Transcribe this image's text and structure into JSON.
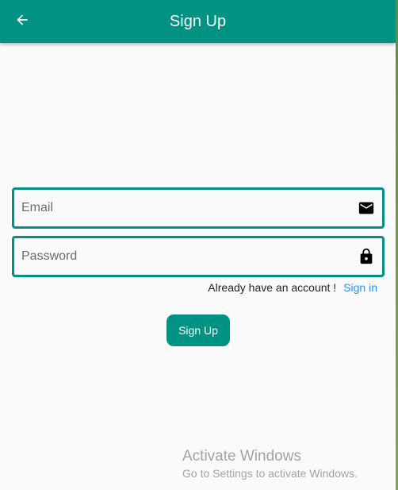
{
  "appbar": {
    "title": "Sign Up",
    "back_icon": "arrow-left-icon",
    "color": "#009384"
  },
  "form": {
    "email": {
      "placeholder": "Email",
      "value": "",
      "icon": "envelope-icon"
    },
    "password": {
      "placeholder": "Password",
      "value": "",
      "icon": "lock-icon"
    },
    "account_prompt": "Already have an account !",
    "signin_link": "Sign in",
    "signup_button": "Sign Up"
  },
  "watermark": {
    "title": "Activate Windows",
    "subtitle": "Go to Settings to activate Windows."
  },
  "colors": {
    "primary": "#009384",
    "link": "#2196f3",
    "background": "#fafafa"
  }
}
